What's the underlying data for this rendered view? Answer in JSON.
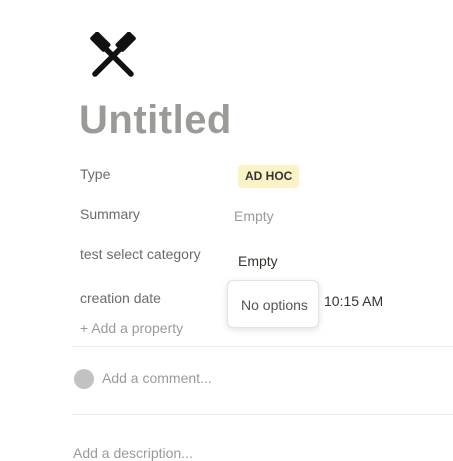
{
  "page": {
    "icon": "hammer-and-pick-icon",
    "title": "Untitled"
  },
  "properties": {
    "type": {
      "label": "Type",
      "value": "AD HOC",
      "tag_color": "#fbf3c6"
    },
    "summary": {
      "label": "Summary",
      "value": "Empty"
    },
    "category": {
      "label": "test select category",
      "value": "Empty"
    },
    "creation_date": {
      "label": "creation date",
      "value": "10:15 AM"
    }
  },
  "add_property_label": "+ Add a property",
  "dropdown": {
    "empty_text": "No options"
  },
  "comment": {
    "placeholder": "Add a comment..."
  },
  "description": {
    "placeholder": "Add a description..."
  }
}
